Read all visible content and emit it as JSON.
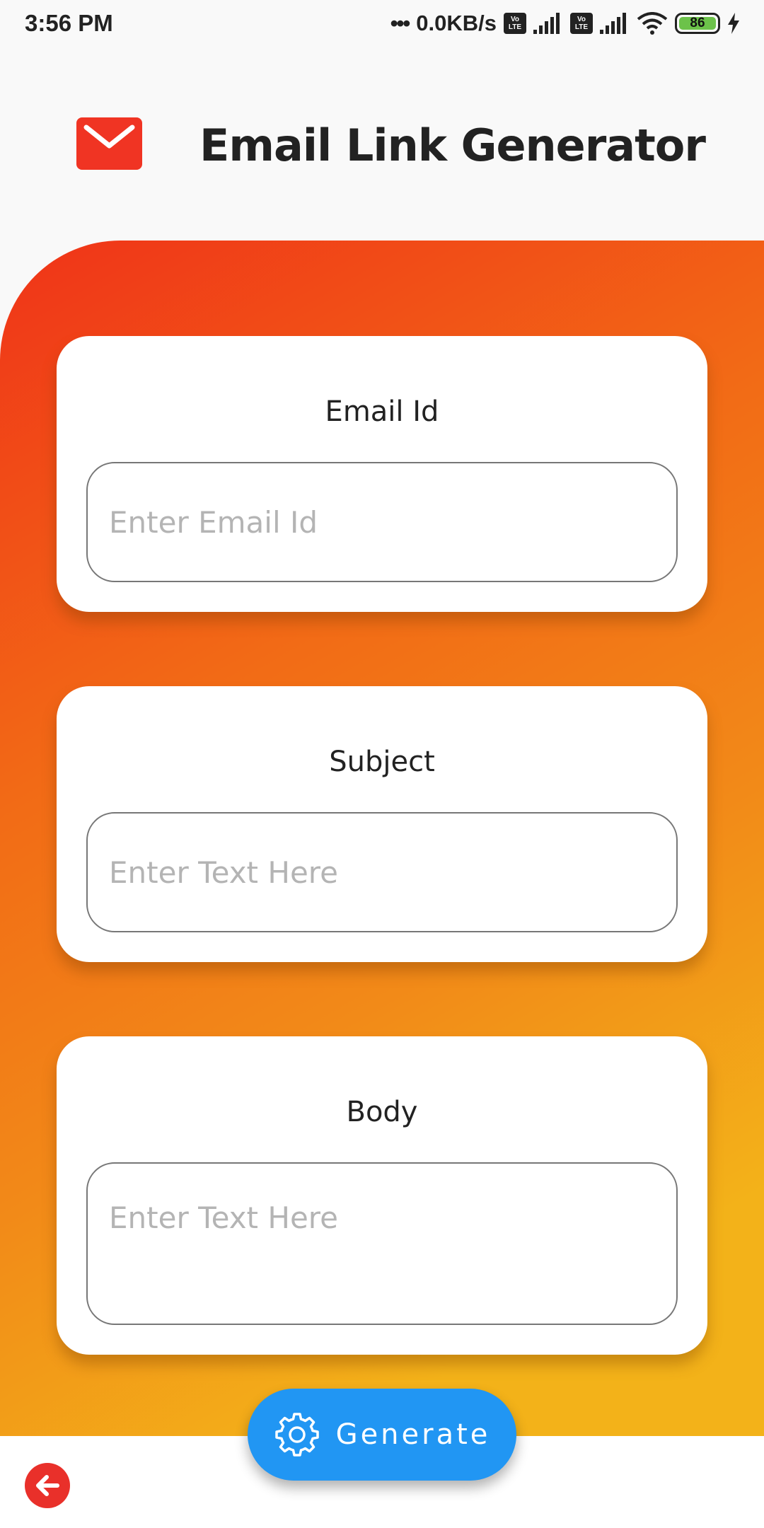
{
  "status_bar": {
    "time": "3:56 PM",
    "dots": "•••",
    "network_speed": "0.0KB/s",
    "volte_label_top": "Vo",
    "volte_label_bottom": "LTE",
    "battery_level": "86",
    "icons": [
      "volte-icon",
      "signal-icon",
      "volte-icon",
      "signal-icon",
      "wifi-icon",
      "battery-icon",
      "charging-icon"
    ]
  },
  "header": {
    "title": "Email Link Generator",
    "logo_icon": "mail-icon",
    "logo_color": "#f03423"
  },
  "form": {
    "email": {
      "label": "Email Id",
      "placeholder": "Enter Email Id",
      "value": ""
    },
    "subject": {
      "label": "Subject",
      "placeholder": "Enter Text Here",
      "value": ""
    },
    "body": {
      "label": "Body",
      "placeholder": "Enter Text Here",
      "value": ""
    }
  },
  "actions": {
    "generate_label": "Generate",
    "generate_icon": "gear-icon",
    "back_icon": "arrow-left-icon"
  },
  "colors": {
    "gradient_start": "#f03318",
    "gradient_end": "#f3b219",
    "primary_button": "#2196f3",
    "back_button": "#e9302a"
  }
}
